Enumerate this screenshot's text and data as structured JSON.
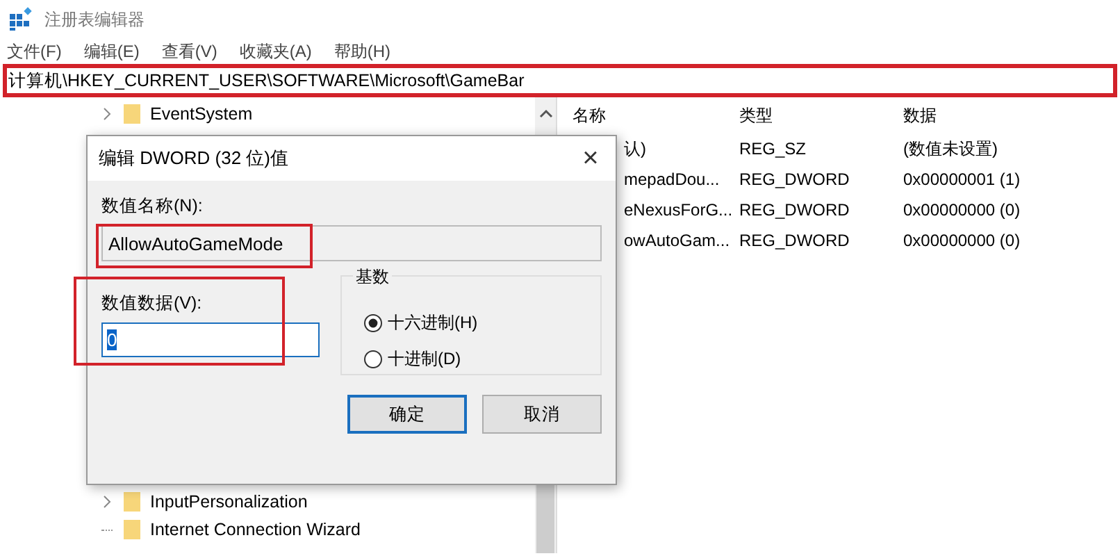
{
  "window": {
    "title": "注册表编辑器"
  },
  "menu": [
    "文件(F)",
    "编辑(E)",
    "查看(V)",
    "收藏夹(A)",
    "帮助(H)"
  ],
  "address": {
    "value": "计算机\\HKEY_CURRENT_USER\\SOFTWARE\\Microsoft\\GameBar",
    "highlighted": true
  },
  "tree": {
    "items_top": [
      {
        "label": "EventSystem",
        "has_children": true
      }
    ],
    "items_bottom": [
      {
        "label": "InputPersonalization",
        "has_children": true
      },
      {
        "label": "Internet Connection Wizard",
        "has_children": false
      }
    ]
  },
  "list": {
    "columns": [
      "名称",
      "类型",
      "数据"
    ],
    "rows": [
      {
        "name": "认)",
        "type": "REG_SZ",
        "data": "(数值未设置)"
      },
      {
        "name": "mepadDou...",
        "type": "REG_DWORD",
        "data": "0x00000001 (1)"
      },
      {
        "name": "eNexusForG...",
        "type": "REG_DWORD",
        "data": "0x00000000 (0)"
      },
      {
        "name": "owAutoGam...",
        "type": "REG_DWORD",
        "data": "0x00000000 (0)"
      }
    ]
  },
  "dialog": {
    "title": "编辑 DWORD (32 位)值",
    "close": "×",
    "name_label": "数值名称(N):",
    "name_value": "AllowAutoGameMode",
    "name_highlighted": true,
    "data_label": "数值数据(V):",
    "data_value": "0",
    "data_highlighted": true,
    "base_label": "基数",
    "bases": [
      {
        "label": "十六进制(H)",
        "selected": true
      },
      {
        "label": "十进制(D)",
        "selected": false
      }
    ],
    "buttons": [
      {
        "label": "确定",
        "default": true
      },
      {
        "label": "取消",
        "default": false
      }
    ]
  }
}
